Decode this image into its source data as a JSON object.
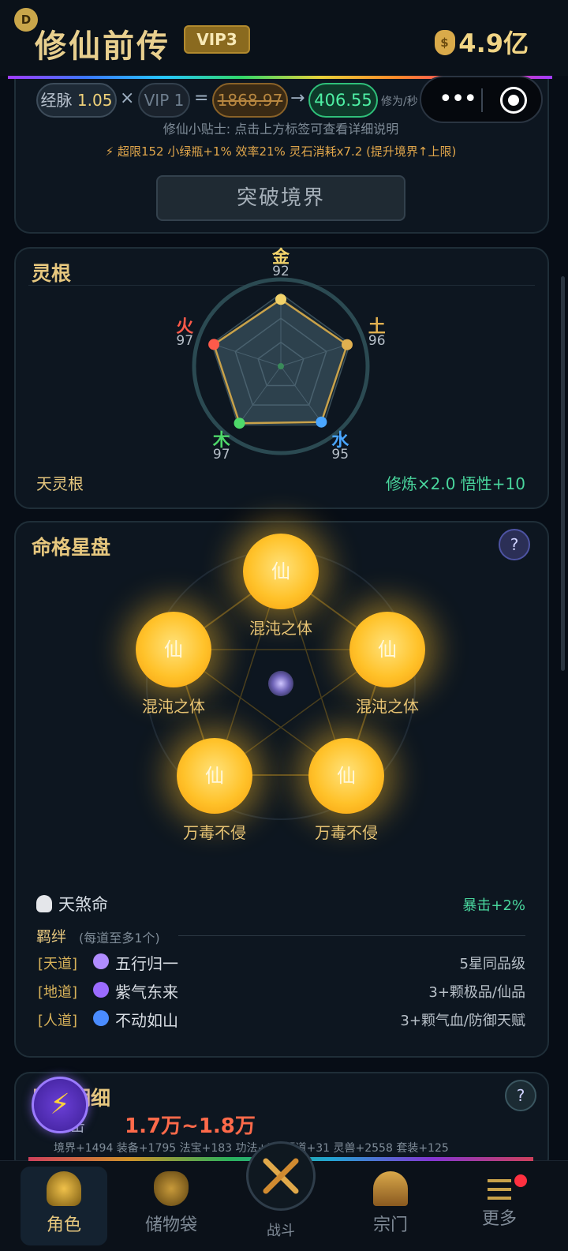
{
  "header": {
    "avatar_letter": "D",
    "title": "修仙前传",
    "vip": "VIP3",
    "currency": "4.9亿",
    "currency_icon": "money-bag-icon"
  },
  "cultivation": {
    "jingmai_label": "经脉",
    "jingmai_value": "1.05",
    "times": "×",
    "vip_pill": "VIP 1",
    "equals": "=",
    "old_rate": "1868.97",
    "arrow": "→",
    "new_rate": "406.55",
    "rate_unit": "修为/秒",
    "tip": "修仙小贴士: 点击上方标签可查看详细说明",
    "extreme": "⚡ 超限152 小绿瓶+1% 效率21% 灵石消耗x7.2 (提升境界↑上限)",
    "breakthrough": "突破境界"
  },
  "spirit_root": {
    "title": "灵根",
    "elements": [
      {
        "name": "金",
        "value": 92,
        "color": "#f2d36b"
      },
      {
        "name": "土",
        "value": 96,
        "color": "#e0b050"
      },
      {
        "name": "水",
        "value": 95,
        "color": "#4aa6ff"
      },
      {
        "name": "木",
        "value": 97,
        "color": "#4ed96a"
      },
      {
        "name": "火",
        "value": 97,
        "color": "#ff5a4a"
      }
    ],
    "root_name": "天灵根",
    "bonus": "修炼×2.0  悟性+10"
  },
  "star_chart": {
    "title": "命格星盘",
    "help": "?",
    "orbs": [
      {
        "glyph": "仙",
        "label": "混沌之体"
      },
      {
        "glyph": "仙",
        "label": "混沌之体"
      },
      {
        "glyph": "仙",
        "label": "混沌之体"
      },
      {
        "glyph": "仙",
        "label": "万毒不侵"
      },
      {
        "glyph": "仙",
        "label": "万毒不侵"
      }
    ],
    "fate": "天煞命",
    "crit": "暴击+2%",
    "bond_title": "羁绊",
    "bond_sub": "(每道至多1个)",
    "bonds": [
      {
        "tag": "[天道]",
        "name": "五行归一",
        "req": "5星同品级",
        "icon_color": "#b08cff",
        "icon": "yin-yang-icon"
      },
      {
        "tag": "[地道]",
        "name": "紫气东来",
        "req": "3+颗极品/仙品",
        "icon_color": "#9b6bff",
        "icon": "crystal-ball-icon"
      },
      {
        "tag": "[人道]",
        "name": "不动如山",
        "req": "3+颗气血/防御天赋",
        "icon_color": "#4a8cff",
        "icon": "shield-icon"
      }
    ]
  },
  "attributes": {
    "title": "属性明细",
    "help": "?",
    "attack_label": "攻击",
    "amount": "1.7万~1.8万",
    "breakdown": "境界+1494  装备+1795  法宝+183  功法+50  悟道+31  灵兽+2558  套装+125"
  },
  "fab": {
    "icon": "lightning-icon",
    "glyph": "⚡"
  },
  "nav": {
    "items": [
      {
        "label": "角色",
        "icon": "meditation-icon"
      },
      {
        "label": "储物袋",
        "icon": "treasure-bag-icon"
      },
      {
        "label": "战斗",
        "icon": "crossed-swords-icon"
      },
      {
        "label": "宗门",
        "icon": "temple-icon"
      },
      {
        "label": "更多",
        "icon": "menu-icon"
      }
    ]
  },
  "capsule": {
    "dots": "•••"
  }
}
